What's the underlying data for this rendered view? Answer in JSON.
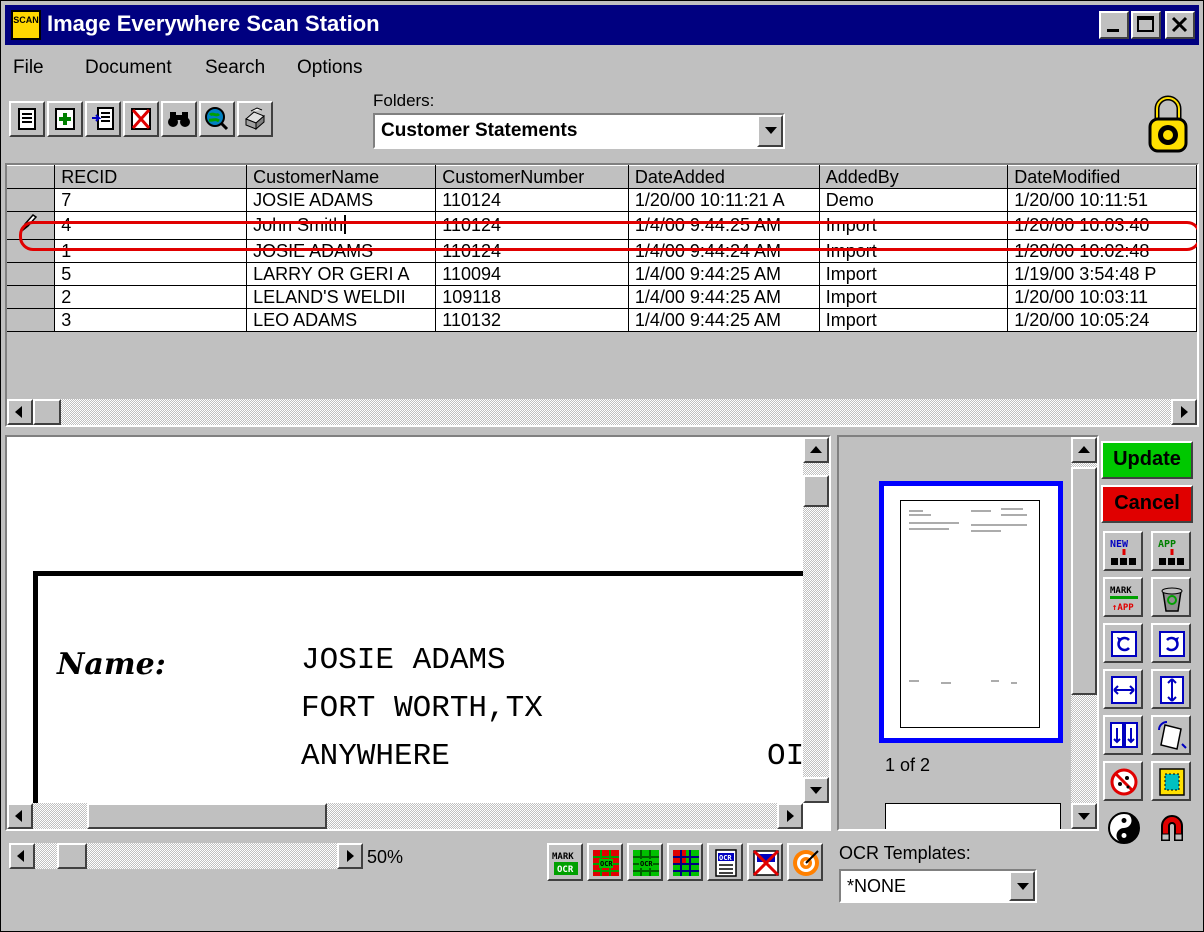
{
  "window": {
    "title": "Image Everywhere Scan Station",
    "icon_text": "SCAN"
  },
  "title_buttons": [
    "minimize-icon",
    "maximize-icon",
    "close-icon"
  ],
  "menu": [
    {
      "label": "File",
      "hotkey": "F"
    },
    {
      "label": "Document",
      "hotkey": "D"
    },
    {
      "label": "Search",
      "hotkey": "S"
    },
    {
      "label": "Options",
      "hotkey": "O"
    }
  ],
  "toolbar": {
    "buttons": [
      "document-list-icon",
      "add-icon",
      "properties-icon",
      "delete-icon",
      "binoculars-icon",
      "web-search-icon",
      "print-icon"
    ],
    "folders_label": "Folders:",
    "folders_value": "Customer Statements",
    "lock_icon": "padlock-icon"
  },
  "grid": {
    "columns": [
      "RECID",
      "CustomerName",
      "CustomerNumber",
      "DateAdded",
      "AddedBy",
      "DateModified"
    ],
    "rows": [
      [
        "7",
        "JOSIE ADAMS",
        "110124",
        "1/20/00 10:11:21 A",
        "Demo",
        "1/20/00 10:11:51"
      ],
      [
        "4",
        "John Smith",
        "110124",
        "1/4/00 9:44:25 AM",
        "Import",
        "1/20/00 10:03:40"
      ],
      [
        "1",
        "JOSIE ADAMS",
        "110124",
        "1/4/00 9:44:24 AM",
        "Import",
        "1/20/00 10:02:48"
      ],
      [
        "5",
        "LARRY OR GERI A",
        "110094",
        "1/4/00 9:44:25 AM",
        "Import",
        "1/19/00 3:54:48 P"
      ],
      [
        "2",
        "LELAND'S WELDII",
        "109118",
        "1/4/00 9:44:25 AM",
        "Import",
        "1/20/00 10:03:11"
      ],
      [
        "3",
        "LEO ADAMS",
        "110132",
        "1/4/00 9:44:25 AM",
        "Import",
        "1/20/00 10:05:24"
      ]
    ],
    "editing_row_index": 1,
    "highlight_color": "#e00000"
  },
  "document": {
    "name_label": "Name:",
    "lines": [
      "JOSIE ADAMS",
      "FORT WORTH,TX",
      "ANYWHERE"
    ],
    "partial_text": "OI"
  },
  "thumbnails": {
    "page_label": "1 of 2"
  },
  "side_buttons": {
    "update_label": "Update",
    "cancel_label": "Cancel",
    "update_color": "#00c800",
    "cancel_color": "#e00000",
    "icons": [
      "new-document-icon",
      "append-document-icon",
      "mark-append-icon",
      "recycle-icon",
      "rotate-left-icon",
      "rotate-right-icon",
      "fit-width-icon",
      "fit-height-icon",
      "flip-icon",
      "deskew-icon",
      "despeckle-icon",
      "crop-icon",
      "invert-icon",
      "magnet-icon"
    ]
  },
  "bottom": {
    "zoom_label": "50%",
    "ocr_buttons": [
      "mark-ocr-icon",
      "ocr-zone-icon",
      "ocr-page-icon",
      "ocr-grid-icon",
      "ocr-scan-icon",
      "ocr-delete-icon",
      "target-icon"
    ],
    "ocr_templates_label": "OCR Templates:",
    "ocr_templates_value": "*NONE"
  }
}
